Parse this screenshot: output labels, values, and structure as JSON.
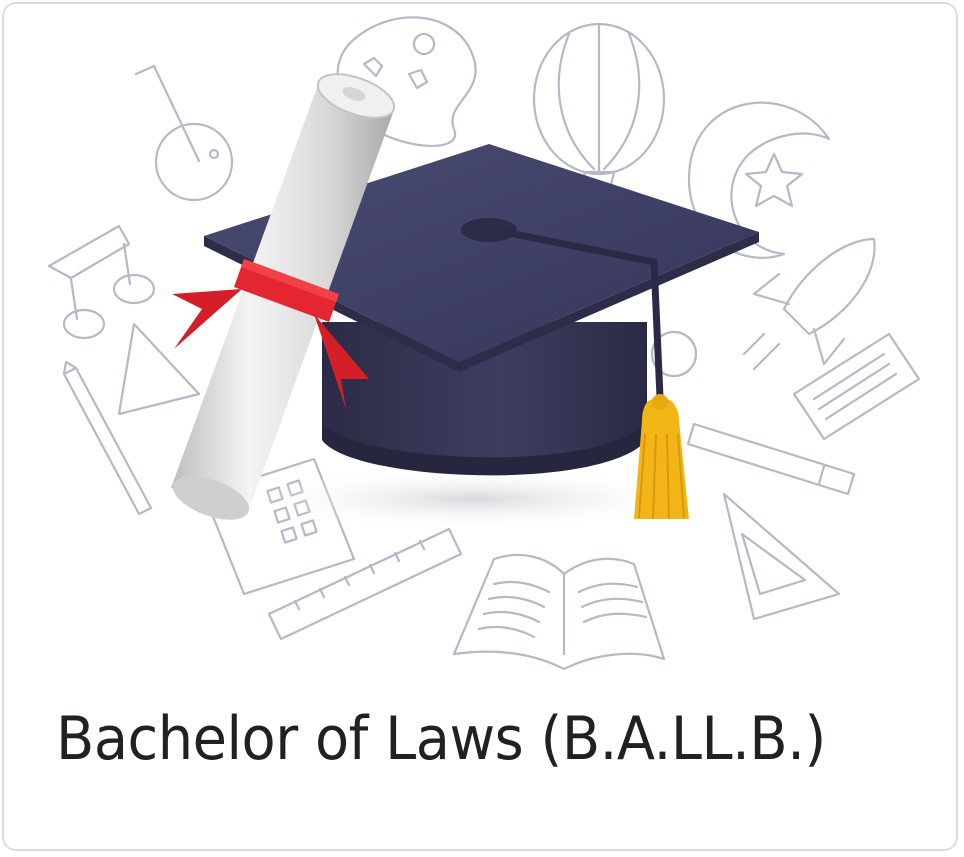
{
  "card": {
    "title": "Bachelor of Laws (B.A.LL.B.)"
  },
  "illustration": {
    "subject": "graduation-cap-and-diploma-icon"
  },
  "colors": {
    "cap": "#3a3a5c",
    "cap_top": "#414266",
    "ribbon": "#e3262f",
    "tassel": "#f2b518",
    "scroll": "#e4e4e4",
    "doodle_stroke": "#b6b8c8",
    "title_text": "#202124",
    "card_border": "#dcdcdc"
  }
}
